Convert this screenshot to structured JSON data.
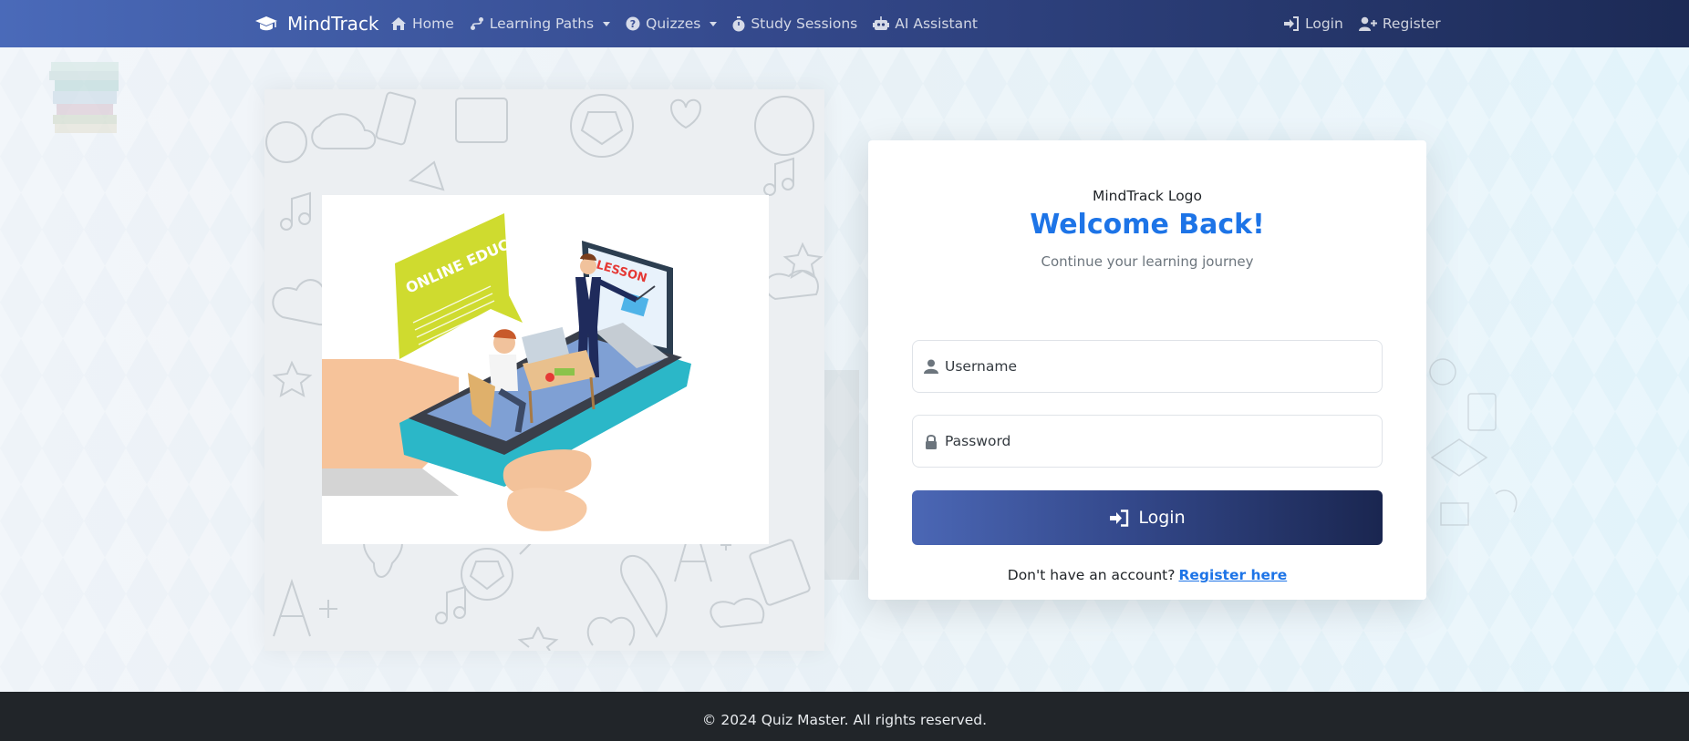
{
  "navbar": {
    "brand": "MindTrack",
    "items": [
      {
        "label": "Home",
        "icon": "home-icon"
      },
      {
        "label": "Learning Paths",
        "icon": "route-icon",
        "dropdown": true
      },
      {
        "label": "Quizzes",
        "icon": "question-circle-icon",
        "dropdown": true
      },
      {
        "label": "Study Sessions",
        "icon": "stopwatch-icon"
      },
      {
        "label": "AI Assistant",
        "icon": "robot-icon"
      }
    ],
    "right": [
      {
        "label": "Login",
        "icon": "sign-in-icon"
      },
      {
        "label": "Register",
        "icon": "user-plus-icon"
      }
    ]
  },
  "illustration": {
    "bubble_title": "ONLINE EDUCATION",
    "screen_text": "LESSON"
  },
  "login": {
    "logo_alt": "MindTrack Logo",
    "title": "Welcome Back!",
    "subtitle": "Continue your learning journey",
    "username_placeholder": "Username",
    "password_placeholder": "Password",
    "button_label": "Login",
    "signup_prompt": "Don't have an account?",
    "signup_link": "Register here"
  },
  "footer": {
    "text": "© 2024 Quiz Master. All rights reserved."
  },
  "colors": {
    "nav_gradient_start": "#4a6ab9",
    "nav_gradient_end": "#1c2a55",
    "title_blue": "#1d74e7",
    "footer_bg": "#212529"
  }
}
